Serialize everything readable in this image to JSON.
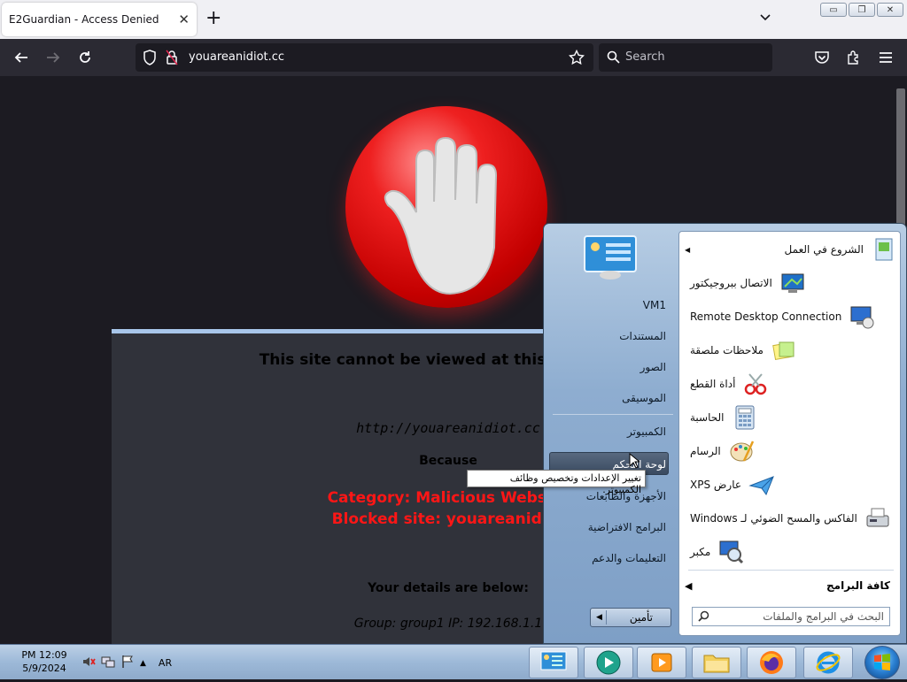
{
  "browser": {
    "tab_title": "E2Guardian - Access Denied",
    "url": "youareanidiot.cc",
    "search_placeholder": "Search"
  },
  "page": {
    "heading": "This site cannot be viewed at this time, reac",
    "blocked_url": "http://youareanidiot.cc",
    "because": "Because",
    "category": "Category: Malicious Website",
    "blocked_site": "Blocked site: youareanidiot",
    "details_heading": "Your details are below:",
    "details": "Group: group1   IP: 192.168.1.1"
  },
  "start_menu": {
    "programs": [
      {
        "label": "الشروع في العمل",
        "icon": "getting-started-icon",
        "arrow": true
      },
      {
        "label": "الاتصال ببروجيكتور",
        "icon": "projector-icon"
      },
      {
        "label": "Remote Desktop Connection",
        "icon": "remote-desktop-icon"
      },
      {
        "label": "ملاحظات ملصقة",
        "icon": "sticky-notes-icon"
      },
      {
        "label": "أداة القطع",
        "icon": "snipping-tool-icon"
      },
      {
        "label": "الحاسبة",
        "icon": "calculator-icon"
      },
      {
        "label": "الرسام",
        "icon": "paint-icon"
      },
      {
        "label": "عارض XPS",
        "icon": "xps-viewer-icon"
      },
      {
        "label": "الفاكس والمسح الضوئي لـ Windows",
        "icon": "fax-scan-icon"
      },
      {
        "label": "مكبر",
        "icon": "magnifier-icon"
      }
    ],
    "all_programs": "كافة البرامج",
    "search_placeholder": "البحث في البرامج والملفات",
    "right": {
      "user": "VM1",
      "documents": "المستندات",
      "pictures": "الصور",
      "music": "الموسيقى",
      "computer": "الكمبيوتر",
      "control_panel": "لوحة التحكم",
      "devices": "الأجهزة والطابعات",
      "default_programs": "البرامج الافتراضية",
      "help": "التعليمات والدعم",
      "shutdown": "تأمين"
    },
    "tooltip": "تغيير الإعدادات وتخصيص وظائف الكمبيوتر."
  },
  "taskbar": {
    "time": "PM 12:09",
    "date": "5/9/2024",
    "language": "AR"
  },
  "colors": {
    "blocked_red": "#ff1616",
    "page_bg": "#1c1b22",
    "box_bg": "#30323a"
  }
}
